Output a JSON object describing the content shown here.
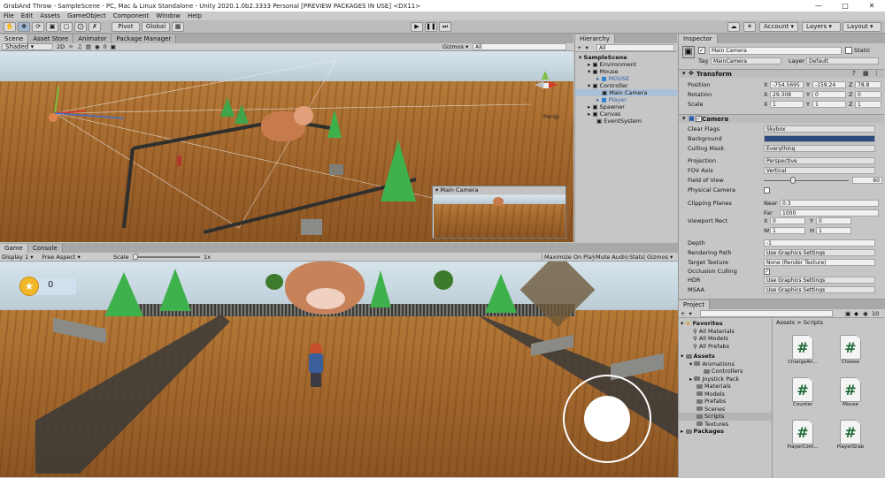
{
  "window": {
    "title": "GrabAnd Throw - SampleScene - PC, Mac & Linux Standalone - Unity 2020.1.0b2.3333 Personal [PREVIEW PACKAGES IN USE] <DX11>"
  },
  "menu": [
    "File",
    "Edit",
    "Assets",
    "GameObject",
    "Component",
    "Window",
    "Help"
  ],
  "toolbar": {
    "pivot": "Pivot",
    "global": "Global",
    "account": "Account",
    "layers": "Layers",
    "layout": "Layout"
  },
  "scene": {
    "tabs": [
      "Scene",
      "Asset Store",
      "Animator",
      "Package Manager"
    ],
    "shading": "Shaded",
    "mode": "2D",
    "gizmos": "Gizmos",
    "gizmo_search": "All",
    "persp": "Persp",
    "hidden_count": "0",
    "camera_preview_title": "Main Camera"
  },
  "game": {
    "tabs": [
      "Game",
      "Console"
    ],
    "display": "Display 1",
    "aspect": "Free Aspect",
    "scale_label": "Scale",
    "scale_value": "1x",
    "buttons": [
      "Maximize On Play",
      "Mute Audio",
      "Stats",
      "Gizmos"
    ],
    "coin_count": "0"
  },
  "hierarchy": {
    "title": "Hierarchy",
    "add": "+",
    "search_placeholder": "All",
    "items": [
      {
        "label": "SampleScene",
        "depth": 0,
        "bold": true
      },
      {
        "label": "Environment",
        "depth": 1
      },
      {
        "label": "Mouse",
        "depth": 1
      },
      {
        "label": "MOUSE",
        "depth": 2,
        "prefab": true
      },
      {
        "label": "Controller",
        "depth": 1
      },
      {
        "label": "Main Camera",
        "depth": 2,
        "selected": true
      },
      {
        "label": "Player",
        "depth": 2,
        "prefab": true
      },
      {
        "label": "Spawner",
        "depth": 1
      },
      {
        "label": "Canvas",
        "depth": 1
      },
      {
        "label": "EventSystem",
        "depth": 1
      }
    ]
  },
  "inspector": {
    "title": "Inspector",
    "object_name": "Main Camera",
    "static_label": "Static",
    "tag_label": "Tag",
    "tag_value": "MainCamera",
    "layer_label": "Layer",
    "layer_value": "Default",
    "transform": {
      "title": "Transform",
      "position": {
        "label": "Position",
        "x": "-754.5695",
        "y": "-159.24",
        "z": "78.8"
      },
      "rotation": {
        "label": "Rotation",
        "x": "29.308",
        "y": "0",
        "z": "0"
      },
      "scale": {
        "label": "Scale",
        "x": "1",
        "y": "1",
        "z": "1"
      }
    },
    "camera": {
      "title": "Camera",
      "clear_flags": {
        "label": "Clear Flags",
        "value": "Skybox"
      },
      "background": {
        "label": "Background",
        "color": "#2c4a7a"
      },
      "culling_mask": {
        "label": "Culling Mask",
        "value": "Everything"
      },
      "projection": {
        "label": "Projection",
        "value": "Perspective"
      },
      "fov_axis": {
        "label": "FOV Axis",
        "value": "Vertical"
      },
      "field_of_view": {
        "label": "Field of View",
        "value": "60"
      },
      "physical_camera": {
        "label": "Physical Camera"
      },
      "clipping": {
        "label": "Clipping Planes",
        "near_label": "Near",
        "near": "0.3",
        "far_label": "Far",
        "far": "1000"
      },
      "viewport": {
        "label": "Viewport Rect",
        "x": "0",
        "y": "0",
        "w": "1",
        "h": "1"
      },
      "depth": {
        "label": "Depth",
        "value": "-1"
      },
      "rendering_path": {
        "label": "Rendering Path",
        "value": "Use Graphics Settings"
      },
      "target_texture": {
        "label": "Target Texture",
        "value": "None (Render Texture)"
      },
      "occlusion_culling": {
        "label": "Occlusion Culling"
      },
      "hdr": {
        "label": "HDR",
        "value": "Use Graphics Settings"
      },
      "msaa": {
        "label": "MSAA",
        "value": "Use Graphics Settings"
      }
    }
  },
  "project": {
    "title": "Project",
    "add": "+",
    "count": "10",
    "tree": [
      {
        "label": "Favorites",
        "depth": 0,
        "bold": true
      },
      {
        "label": "All Materials",
        "depth": 1
      },
      {
        "label": "All Models",
        "depth": 1
      },
      {
        "label": "All Prefabs",
        "depth": 1
      },
      {
        "label": "Assets",
        "depth": 0,
        "bold": true
      },
      {
        "label": "Animations",
        "depth": 1
      },
      {
        "label": "Controllers",
        "depth": 2
      },
      {
        "label": "Joystick Pack",
        "depth": 1
      },
      {
        "label": "Materials",
        "depth": 1
      },
      {
        "label": "Models",
        "depth": 1
      },
      {
        "label": "Prefabs",
        "depth": 1
      },
      {
        "label": "Scenes",
        "depth": 1
      },
      {
        "label": "Scripts",
        "depth": 1,
        "selected": true
      },
      {
        "label": "Textures",
        "depth": 1
      },
      {
        "label": "Packages",
        "depth": 0,
        "bold": true
      }
    ],
    "breadcrumb": [
      "Assets",
      "Scripts"
    ],
    "scripts": [
      "ChangeAn...",
      "Cheese",
      "Counter",
      "Mouse",
      "PlayerCont...",
      "PlayerGrab"
    ]
  }
}
